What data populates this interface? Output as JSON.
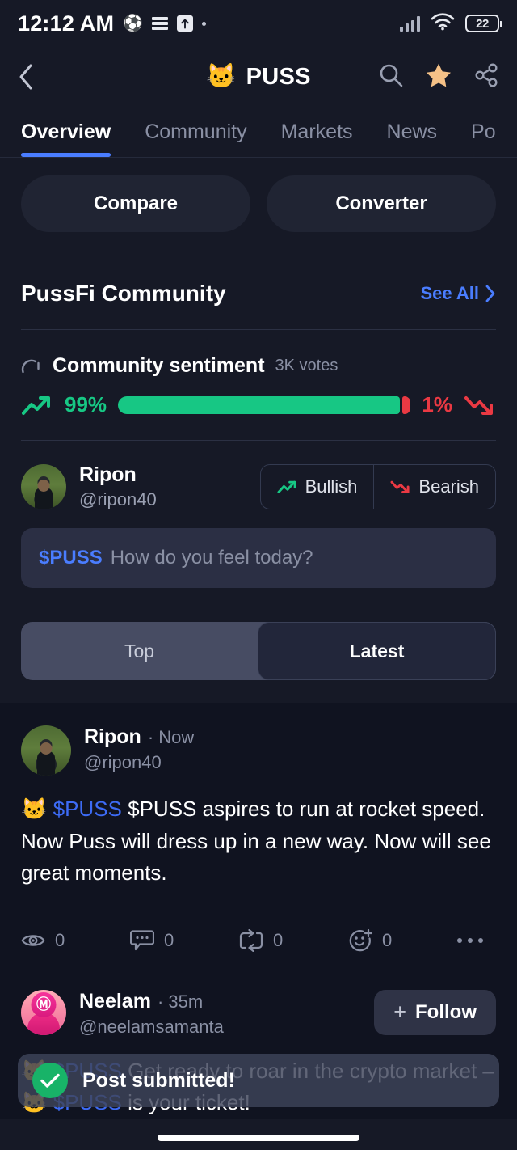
{
  "status_bar": {
    "time": "12:12 AM",
    "icons": [
      "soccer-ball-emoji",
      "layers-icon",
      "upload-box-icon",
      "dot-icon"
    ],
    "soccer_emoji": "⚽",
    "battery_level": "22",
    "signal_icon": "cellular-signal-icon",
    "wifi_icon": "wifi-icon"
  },
  "header": {
    "back_icon": "chevron-left-icon",
    "logo_emoji": "🐱",
    "title": "PUSS",
    "search_icon": "search-icon",
    "favorite_icon": "star-icon",
    "share_icon": "share-icon"
  },
  "tabs": [
    {
      "label": "Overview",
      "active": true
    },
    {
      "label": "Community",
      "active": false
    },
    {
      "label": "Markets",
      "active": false
    },
    {
      "label": "News",
      "active": false
    },
    {
      "label": "Po",
      "active": false
    }
  ],
  "quick_actions": {
    "compare_label": "Compare",
    "converter_label": "Converter"
  },
  "community": {
    "section_title": "PussFi Community",
    "see_all_label": "See All",
    "see_all_chevron": "chevron-right-icon",
    "sentiment": {
      "label": "Community sentiment",
      "votes": "3K votes",
      "gauge_icon": "gauge-icon",
      "bullish_pct": "99%",
      "bearish_pct": "1%",
      "bullish_value": 99,
      "bearish_value": 1,
      "bullish_color": "#17c784",
      "bearish_color": "#ea3943",
      "trend_up_icon": "trend-up-icon",
      "trend_down_icon": "trend-down-icon"
    }
  },
  "composer": {
    "user_name": "Ripon",
    "user_handle": "@ripon40",
    "bullish_label": "Bullish",
    "bearish_label": "Bearish",
    "ticker": "$PUSS",
    "placeholder": "How do you feel today?",
    "input_value": ""
  },
  "feed_filter": {
    "top_label": "Top",
    "latest_label": "Latest",
    "selected": "Latest"
  },
  "posts": [
    {
      "author": "Ripon",
      "handle": "@ripon40",
      "time": "Now",
      "avatar": "ripon-avatar",
      "emoji": "🐱",
      "ticker": "$PUSS",
      "body": "$PUSS aspires to run at rocket speed. Now Puss will dress up in a new way. Now will see great moments.",
      "actions": [
        {
          "icon": "eye-icon",
          "count": "0"
        },
        {
          "icon": "comment-icon",
          "count": "0"
        },
        {
          "icon": "repost-icon",
          "count": "0"
        },
        {
          "icon": "add-reaction-icon",
          "count": "0"
        }
      ],
      "more_icon": "more-horizontal-icon"
    },
    {
      "author": "Neelam",
      "handle": "@neelamsamanta",
      "time": "35m",
      "avatar": "neelam-avatar",
      "follow_label": "Follow",
      "follow_plus": "+",
      "emoji": "🐱",
      "ticker": "$PUSS",
      "body_line1": "Get ready to roar in the crypto",
      "body_line2_pre": "market – ",
      "body_line2_post": " is your ticket!"
    }
  ],
  "toast": {
    "message": "Post submitted!",
    "icon": "check-circle-icon",
    "icon_color": "#18b368"
  },
  "colors": {
    "background": "#161926",
    "feed_background": "#101320",
    "accent_blue": "#4a7dff",
    "ticker_blue": "#3d6bf5",
    "star_orange": "#f5c187",
    "muted_text": "#8a90a4"
  }
}
